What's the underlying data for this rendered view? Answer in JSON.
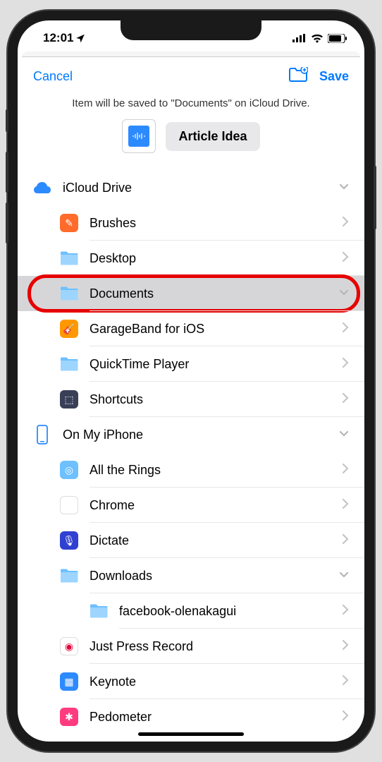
{
  "status": {
    "time": "12:01"
  },
  "header": {
    "cancel": "Cancel",
    "save": "Save",
    "subtitle": "Item will be saved to \"Documents\" on iCloud Drive."
  },
  "item": {
    "filename": "Article Idea"
  },
  "locations": [
    {
      "name": "icloud-drive",
      "label": "iCloud Drive",
      "icon": "cloud",
      "indent": 0,
      "accessory": "down",
      "border": false
    },
    {
      "name": "brushes",
      "label": "Brushes",
      "icon": "app-brushes",
      "indent": 1,
      "accessory": "right",
      "border": true
    },
    {
      "name": "desktop",
      "label": "Desktop",
      "icon": "folder-cube",
      "indent": 1,
      "accessory": "right",
      "border": true
    },
    {
      "name": "documents",
      "label": "Documents",
      "icon": "folder-doc",
      "indent": 1,
      "accessory": "down",
      "border": true,
      "selected": true,
      "highlighted": true
    },
    {
      "name": "garageband",
      "label": "GarageBand for iOS",
      "icon": "app-garage",
      "indent": 1,
      "accessory": "right",
      "border": true
    },
    {
      "name": "quicktime",
      "label": "QuickTime Player",
      "icon": "folder-plain",
      "indent": 1,
      "accessory": "right",
      "border": true
    },
    {
      "name": "shortcuts",
      "label": "Shortcuts",
      "icon": "app-shortcuts",
      "indent": 1,
      "accessory": "right",
      "border": true
    },
    {
      "name": "on-my-iphone",
      "label": "On My iPhone",
      "icon": "iphone",
      "indent": 0,
      "accessory": "down",
      "border": false
    },
    {
      "name": "all-the-rings",
      "label": "All the Rings",
      "icon": "app-rings",
      "indent": 1,
      "accessory": "right",
      "border": true
    },
    {
      "name": "chrome",
      "label": "Chrome",
      "icon": "app-chrome",
      "indent": 1,
      "accessory": "right",
      "border": true
    },
    {
      "name": "dictate",
      "label": "Dictate",
      "icon": "app-dictate",
      "indent": 1,
      "accessory": "right",
      "border": true
    },
    {
      "name": "downloads",
      "label": "Downloads",
      "icon": "folder-down",
      "indent": 1,
      "accessory": "down",
      "border": true
    },
    {
      "name": "facebook-folder",
      "label": "facebook-olenakagui",
      "icon": "folder-plain",
      "indent": 2,
      "accessory": "right",
      "border": true
    },
    {
      "name": "just-press-record",
      "label": "Just Press Record",
      "icon": "app-jpr",
      "indent": 1,
      "accessory": "right",
      "border": true
    },
    {
      "name": "keynote",
      "label": "Keynote",
      "icon": "app-keynote",
      "indent": 1,
      "accessory": "right",
      "border": true
    },
    {
      "name": "pedometer",
      "label": "Pedometer",
      "icon": "app-pedometer",
      "indent": 1,
      "accessory": "right",
      "border": false
    }
  ]
}
